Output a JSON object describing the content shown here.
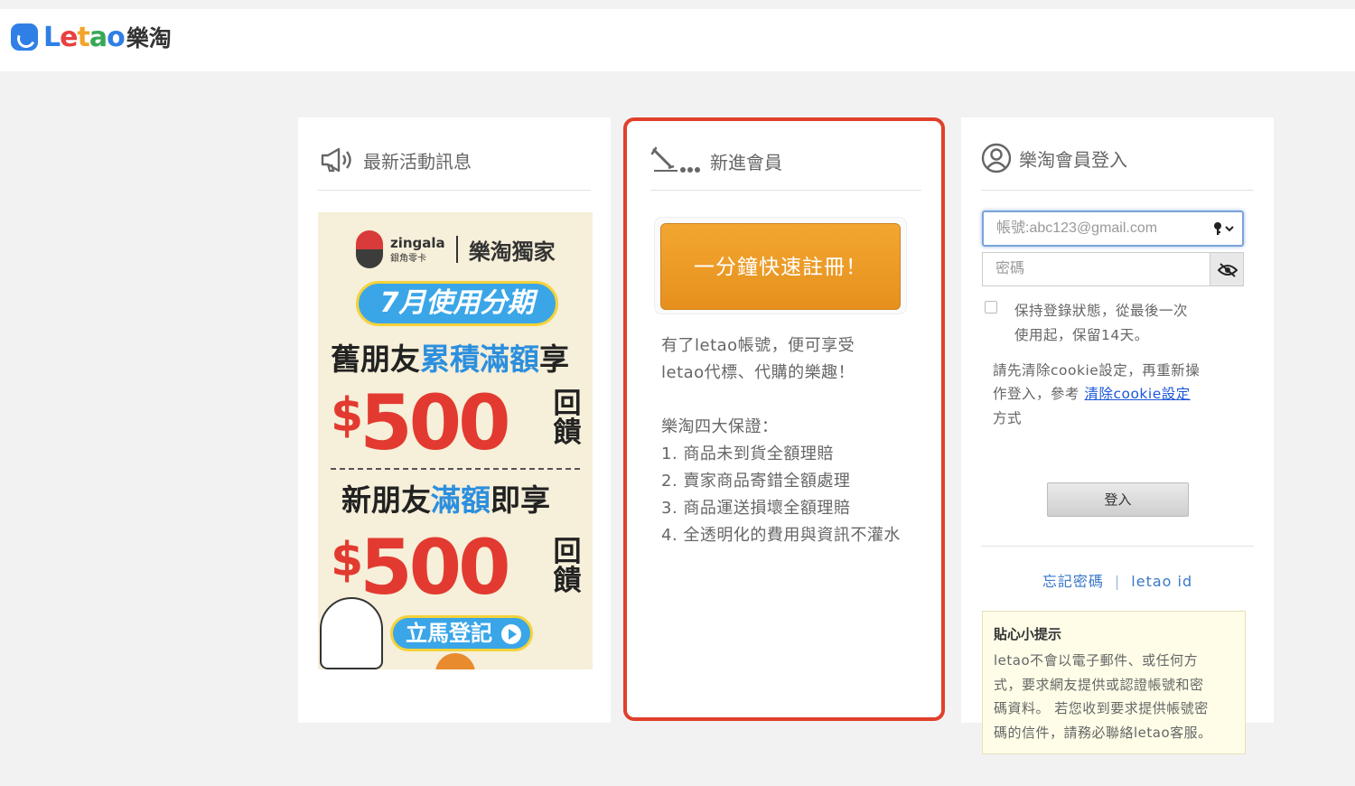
{
  "header": {
    "logo_text": "Letao",
    "logo_cn": "樂淘"
  },
  "promo_panel": {
    "title": "最新活動訊息",
    "banner": {
      "brand": "zingala",
      "brand_sub": "銀角零卡",
      "exclusive": "樂淘獨家",
      "pill": "7月使用分期",
      "line1_a": "舊朋友",
      "line1_hl": "累積滿額",
      "line1_b": "享",
      "amount_currency": "$",
      "amount": "500",
      "feedback": "回饋",
      "line2_a": "新朋友",
      "line2_hl": "滿額",
      "line2_b": "即享",
      "cta": "立馬登記"
    }
  },
  "register_panel": {
    "title": "新進會員",
    "register_button": "一分鐘快速註冊！",
    "intro_line1": "有了letao帳號，便可享受",
    "intro_line2": "letao代標、代購的樂趣！",
    "guarantee_title": "樂淘四大保證：",
    "guarantees": [
      "1. 商品未到貨全額理賠",
      "2. 賣家商品寄錯全額處理",
      "3. 商品運送損壞全額理賠",
      "4. 全透明化的費用與資訊不灌水"
    ]
  },
  "login_panel": {
    "title": "樂淘會員登入",
    "account_placeholder": "帳號:abc123@gmail.com",
    "password_placeholder": "密碼",
    "remember_line1": "保持登錄狀態，從最後一次",
    "remember_line2": "使用起，保留14天。",
    "cookie_line1": "請先清除cookie設定，再重新操",
    "cookie_line2_prefix": "作登入，參考 ",
    "cookie_link": "清除cookie設定",
    "cookie_line3": "方式",
    "login_button": "登入",
    "forgot_password": "忘記密碼",
    "separator": "|",
    "letao_id": "letao id",
    "tips_title": "貼心小提示",
    "tips_lines": [
      "letao不會以電子郵件、或任何方",
      "式，要求網友提供或認證帳號和密",
      "碼資料。 若您收到要求提供帳號密",
      "碼的信件，請務必聯絡letao客服。"
    ]
  },
  "colors": {
    "highlight_border": "#e0402b",
    "register_orange": "#e89a24",
    "link_blue": "#1a57d8",
    "tips_bg": "#fffde8"
  }
}
